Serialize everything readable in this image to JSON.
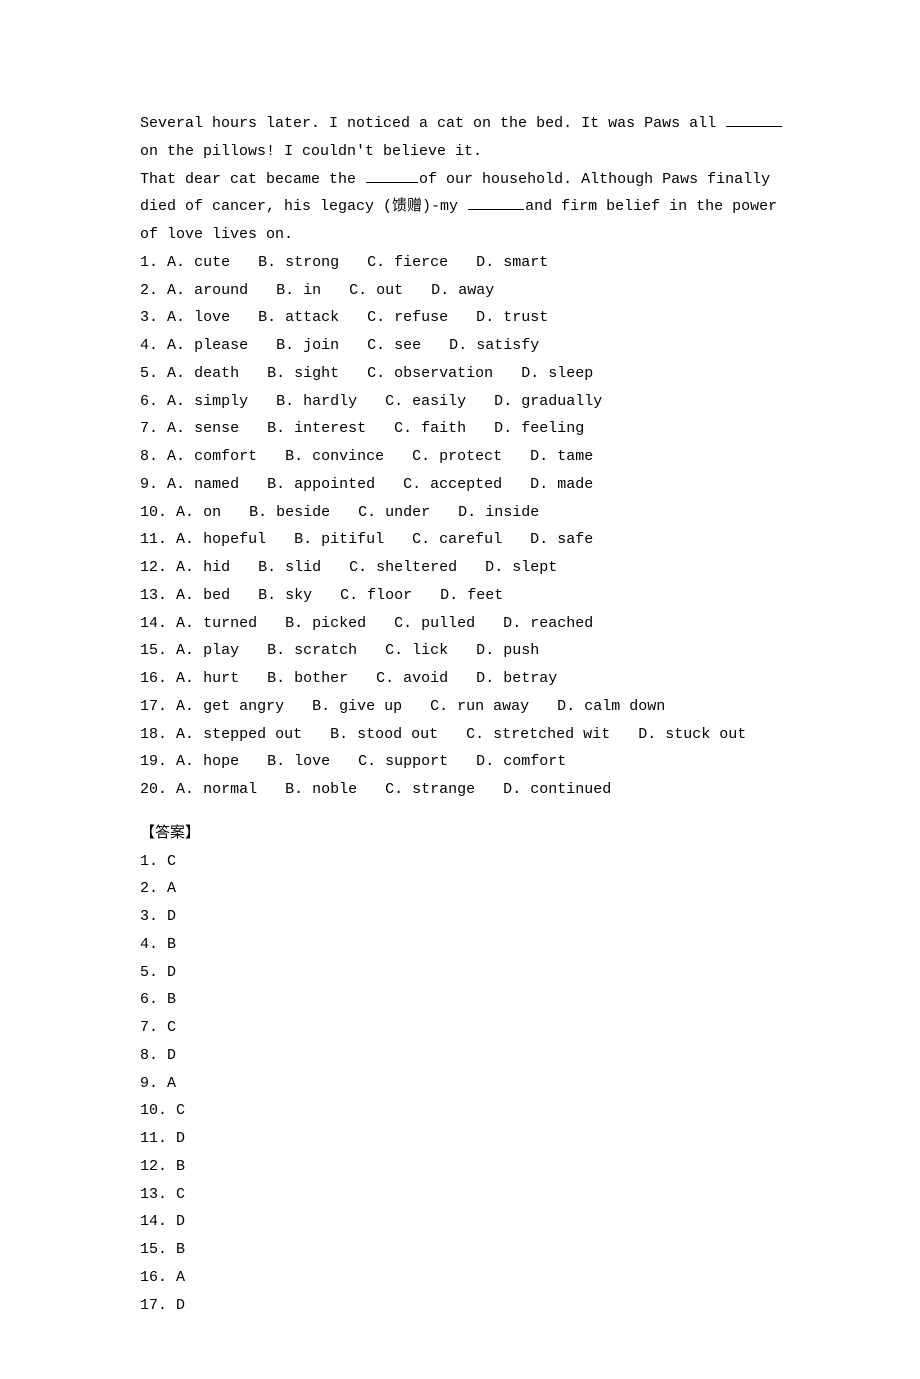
{
  "passage": {
    "p1_a": "Several hours later. I noticed a cat on the bed. It was Paws all ",
    "p1_b": " on the pillows! I couldn't believe it.",
    "p2_a": "That dear cat became the ",
    "p2_b": "of our household. Although Paws finally died of cancer, his legacy (馈赠)-my ",
    "p2_c": "and firm belief in the power of love lives on."
  },
  "questions": [
    {
      "n": "1",
      "opts": [
        [
          "A",
          "cute"
        ],
        [
          "B",
          "strong"
        ],
        [
          "C",
          "fierce"
        ],
        [
          "D",
          "smart"
        ]
      ]
    },
    {
      "n": "2",
      "opts": [
        [
          "A",
          "around"
        ],
        [
          "B",
          "in"
        ],
        [
          "C",
          "out"
        ],
        [
          "D",
          "away"
        ]
      ]
    },
    {
      "n": "3",
      "opts": [
        [
          "A",
          "love"
        ],
        [
          "B",
          "attack"
        ],
        [
          "C",
          "refuse"
        ],
        [
          "D",
          "trust"
        ]
      ]
    },
    {
      "n": "4",
      "opts": [
        [
          "A",
          "please"
        ],
        [
          "B",
          "join"
        ],
        [
          "C",
          "see"
        ],
        [
          "D",
          "satisfy"
        ]
      ]
    },
    {
      "n": "5",
      "opts": [
        [
          "A",
          "death"
        ],
        [
          "B",
          "sight"
        ],
        [
          "C",
          "observation"
        ],
        [
          "D",
          "sleep"
        ]
      ]
    },
    {
      "n": "6",
      "opts": [
        [
          "A",
          "simply"
        ],
        [
          "B",
          "hardly"
        ],
        [
          "C",
          "easily"
        ],
        [
          "D",
          "gradually"
        ]
      ]
    },
    {
      "n": "7",
      "opts": [
        [
          "A",
          "sense"
        ],
        [
          "B",
          "interest"
        ],
        [
          "C",
          "faith"
        ],
        [
          "D",
          "feeling"
        ]
      ]
    },
    {
      "n": "8",
      "opts": [
        [
          "A",
          "comfort"
        ],
        [
          "B",
          "convince"
        ],
        [
          "C",
          "protect"
        ],
        [
          "D",
          "tame"
        ]
      ]
    },
    {
      "n": "9",
      "opts": [
        [
          "A",
          "named"
        ],
        [
          "B",
          "appointed"
        ],
        [
          "C",
          "accepted"
        ],
        [
          "D",
          "made"
        ]
      ]
    },
    {
      "n": "10",
      "opts": [
        [
          "A",
          "on"
        ],
        [
          "B",
          "beside"
        ],
        [
          "C",
          "under"
        ],
        [
          "D",
          "inside"
        ]
      ]
    },
    {
      "n": "11",
      "opts": [
        [
          "A",
          "hopeful"
        ],
        [
          "B",
          "pitiful"
        ],
        [
          "C",
          "careful"
        ],
        [
          "D",
          "safe"
        ]
      ]
    },
    {
      "n": "12",
      "opts": [
        [
          "A",
          "hid"
        ],
        [
          "B",
          "slid"
        ],
        [
          "C",
          "sheltered"
        ],
        [
          "D",
          "slept"
        ]
      ]
    },
    {
      "n": "13",
      "opts": [
        [
          "A",
          "bed"
        ],
        [
          "B",
          "sky"
        ],
        [
          "C",
          "floor"
        ],
        [
          "D",
          "feet"
        ]
      ]
    },
    {
      "n": "14",
      "opts": [
        [
          "A",
          "turned"
        ],
        [
          "B",
          "picked"
        ],
        [
          "C",
          "pulled"
        ],
        [
          "D",
          "reached"
        ]
      ]
    },
    {
      "n": "15",
      "opts": [
        [
          "A",
          "play"
        ],
        [
          "B",
          "scratch"
        ],
        [
          "C",
          "lick"
        ],
        [
          "D",
          "push"
        ]
      ]
    },
    {
      "n": "16",
      "opts": [
        [
          "A",
          "hurt"
        ],
        [
          "B",
          "bother"
        ],
        [
          "C",
          "avoid"
        ],
        [
          "D",
          "betray"
        ]
      ]
    },
    {
      "n": "17",
      "opts": [
        [
          "A",
          "get angry"
        ],
        [
          "B",
          "give up"
        ],
        [
          "C",
          "run away"
        ],
        [
          "D",
          "calm down"
        ]
      ]
    },
    {
      "n": "18",
      "opts": [
        [
          "A",
          "stepped out"
        ],
        [
          "B",
          "stood out"
        ],
        [
          "C",
          "stretched wit"
        ],
        [
          "D",
          "stuck out"
        ]
      ]
    },
    {
      "n": "19",
      "opts": [
        [
          "A",
          "hope"
        ],
        [
          "B",
          "love"
        ],
        [
          "C",
          "support"
        ],
        [
          "D",
          "comfort"
        ]
      ]
    },
    {
      "n": "20",
      "opts": [
        [
          "A",
          "normal"
        ],
        [
          "B",
          "noble"
        ],
        [
          "C",
          "strange"
        ],
        [
          "D",
          "continued"
        ]
      ]
    }
  ],
  "answers_header": "【答案】",
  "answers": [
    {
      "n": "1",
      "a": "C"
    },
    {
      "n": "2",
      "a": "A"
    },
    {
      "n": "3",
      "a": "D"
    },
    {
      "n": "4",
      "a": "B"
    },
    {
      "n": "5",
      "a": "D"
    },
    {
      "n": "6",
      "a": "B"
    },
    {
      "n": "7",
      "a": "C"
    },
    {
      "n": "8",
      "a": "D"
    },
    {
      "n": "9",
      "a": "A"
    },
    {
      "n": "10",
      "a": "C"
    },
    {
      "n": "11",
      "a": "D"
    },
    {
      "n": "12",
      "a": "B"
    },
    {
      "n": "13",
      "a": "C"
    },
    {
      "n": "14",
      "a": "D"
    },
    {
      "n": "15",
      "a": "B"
    },
    {
      "n": "16",
      "a": "A"
    },
    {
      "n": "17",
      "a": "D"
    }
  ]
}
